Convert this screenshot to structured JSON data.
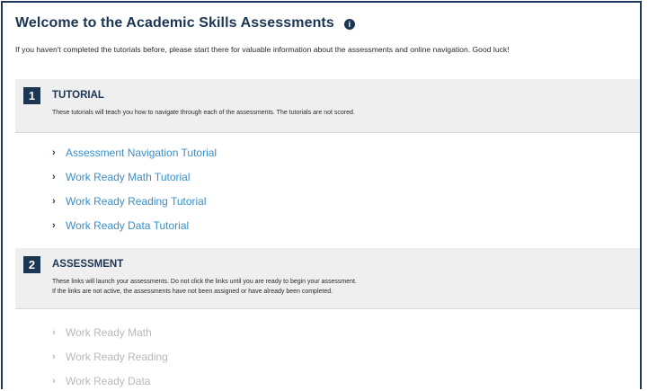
{
  "header": {
    "title": "Welcome to the Academic Skills Assessments",
    "info_icon_glyph": "i",
    "intro": "If you haven't completed the tutorials before, please start there for valuable information about the assessments and online navigation. Good luck!"
  },
  "sections": {
    "tutorial": {
      "number": "1",
      "title": "TUTORIAL",
      "description": "These tutorials will teach you how to navigate through each of the assessments. The tutorials are not scored.",
      "links": [
        {
          "label": "Assessment Navigation Tutorial",
          "chevron": "›"
        },
        {
          "label": "Work Ready Math Tutorial",
          "chevron": "›"
        },
        {
          "label": "Work Ready Reading Tutorial",
          "chevron": "›"
        },
        {
          "label": "Work Ready Data Tutorial",
          "chevron": "›"
        }
      ]
    },
    "assessment": {
      "number": "2",
      "title": "ASSESSMENT",
      "description_line1": "These links will launch your assessments. Do not click the links until you are ready to begin your assessment.",
      "description_line2": "If the links are not active, the assessments have not been assigned or have already been completed.",
      "links": [
        {
          "label": "Work Ready Math",
          "chevron": "›"
        },
        {
          "label": "Work Ready Reading",
          "chevron": "›"
        },
        {
          "label": "Work Ready Data",
          "chevron": "›"
        }
      ]
    }
  },
  "colors": {
    "navy": "#1b3553",
    "link_blue": "#3a8fc9",
    "disabled_gray": "#b8b8b8",
    "header_bg": "#efefef"
  },
  "icons": {
    "info": "info-icon",
    "chevron": "chevron-right-icon"
  }
}
